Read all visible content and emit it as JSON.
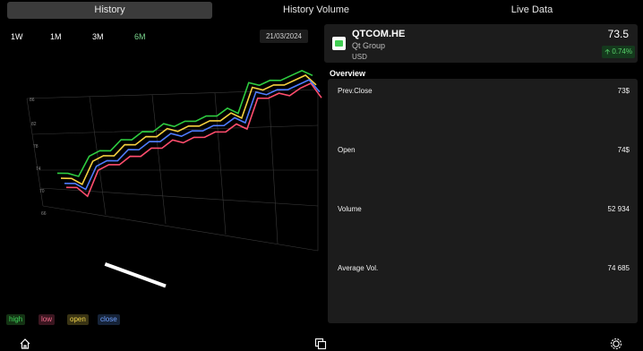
{
  "tabs": [
    "History",
    "History Volume",
    "Live Data"
  ],
  "ranges": [
    "1W",
    "1M",
    "3M",
    "6M"
  ],
  "selected_range": "6M",
  "date": "21/03/2024",
  "legend": [
    "high",
    "low",
    "open",
    "close"
  ],
  "colors": {
    "high": "#2ecc40",
    "low": "#ff4d6d",
    "open": "#f4d03f",
    "close": "#4f7cff",
    "up": "#58d06a"
  },
  "quote": {
    "symbol": "QTCOM.HE",
    "company": "Qt Group",
    "currency": "USD",
    "price": "73.5",
    "change": "0.74%"
  },
  "overview": {
    "title": "Overview",
    "rows": [
      {
        "label": "Prev.Close",
        "value": "73$"
      },
      {
        "label": "Open",
        "value": "74$"
      },
      {
        "label": "Volume",
        "value": "52 934"
      },
      {
        "label": "Average Vol.",
        "value": "74 685"
      }
    ]
  },
  "icons": [
    "home-icon",
    "copy-icon",
    "gear-icon"
  ],
  "chart_data": {
    "type": "line",
    "title": "",
    "series": [
      {
        "name": "high",
        "values": [
          66,
          65,
          63,
          69,
          70,
          69,
          72,
          71,
          73,
          72,
          74,
          72,
          73,
          72,
          73,
          72,
          74,
          71,
          82,
          80,
          81,
          80,
          81,
          82,
          79
        ]
      },
      {
        "name": "low",
        "values": [
          63,
          62,
          58,
          66,
          67,
          66,
          68,
          67,
          69,
          68,
          70,
          68,
          69,
          68,
          69,
          68,
          70,
          67,
          78,
          77,
          78,
          76,
          78,
          79,
          72
        ]
      },
      {
        "name": "open",
        "values": [
          65,
          64,
          61,
          68,
          69,
          68,
          71,
          70,
          72,
          71,
          73,
          71,
          72,
          71,
          72,
          71,
          73,
          70,
          81,
          79,
          80,
          79,
          80,
          81,
          76
        ]
      },
      {
        "name": "close",
        "values": [
          64,
          63,
          60,
          67,
          68,
          67,
          70,
          69,
          71,
          70,
          72,
          70,
          71,
          70,
          71,
          70,
          72,
          69,
          80,
          78,
          79,
          78,
          79,
          80,
          74
        ]
      }
    ]
  }
}
